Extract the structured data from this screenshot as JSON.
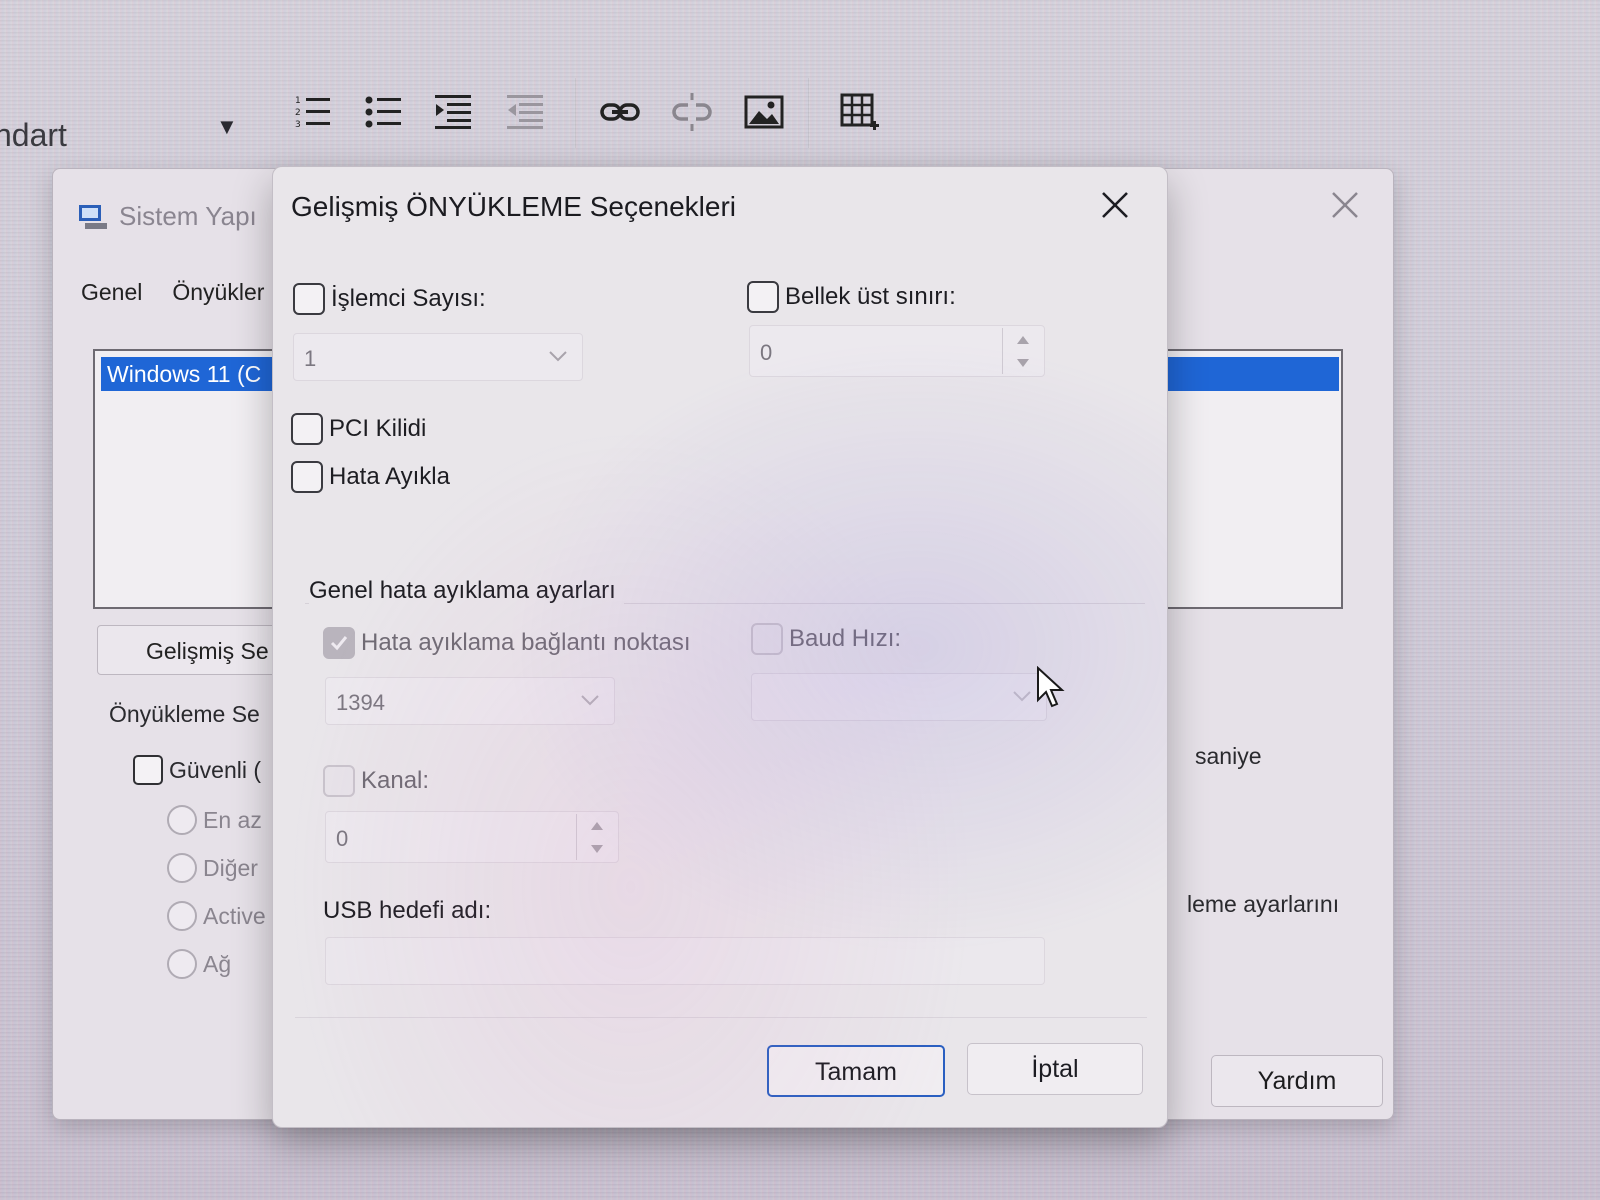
{
  "editor_toolbar": {
    "style_value": "ndart",
    "icons": [
      "numbered-list-icon",
      "bullet-list-icon",
      "indent-icon",
      "outdent-icon",
      "link-icon",
      "unlink-icon",
      "image-icon",
      "table-icon"
    ]
  },
  "back_window": {
    "title": "Sistem Yapı",
    "tabs": [
      "Genel",
      "Önyükler"
    ],
    "os_list": [
      "Windows 11 (C"
    ],
    "advanced_button": "Gelişmiş Se",
    "boot_options_label": "Önyükleme Se",
    "safe_boot_label": "Güvenli (",
    "radios": [
      "En az",
      "Diğer",
      "Active",
      "Ağ"
    ],
    "timeout_unit": "saniye",
    "make_permanent_fragment": "leme ayarlarını",
    "help_button": "Yardım"
  },
  "dialog": {
    "title": "Gelişmiş ÖNYÜKLEME Seçenekleri",
    "processor_count": {
      "label": "İşlemci Sayısı:",
      "value": "1",
      "checked": false
    },
    "max_memory": {
      "label": "Bellek üst sınırı:",
      "value": "0",
      "checked": false
    },
    "pci_lock": {
      "label": "PCI Kilidi",
      "checked": false
    },
    "debug": {
      "label": "Hata Ayıkla",
      "checked": false
    },
    "global_debug_section": "Genel hata ayıklama ayarları",
    "debug_port": {
      "label": "Hata ayıklama bağlantı noktası",
      "value": "1394",
      "checked": true,
      "enabled": false
    },
    "baud_rate": {
      "label": "Baud Hızı:",
      "value": "",
      "checked": false,
      "enabled": false
    },
    "channel": {
      "label": "Kanal:",
      "value": "0",
      "checked": false,
      "enabled": false
    },
    "usb_target": {
      "label": "USB hedefi adı:",
      "value": ""
    },
    "ok_button": "Tamam",
    "cancel_button": "İptal"
  },
  "colors": {
    "selection_blue": "#1f66d6",
    "primary_border": "#2a5fc1"
  }
}
